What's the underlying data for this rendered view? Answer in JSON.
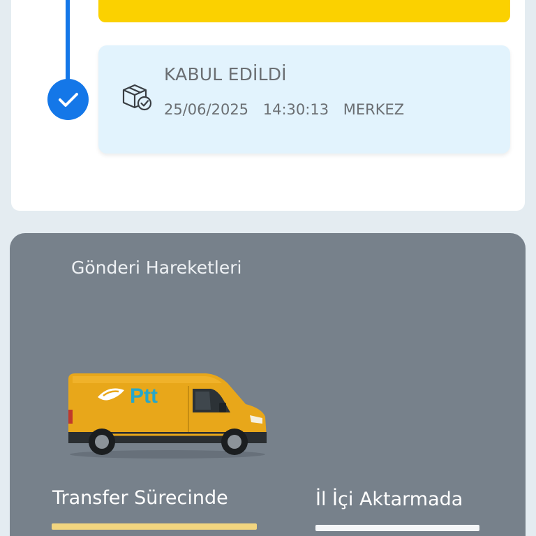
{
  "timeline": {
    "event": {
      "status": "KABUL EDİLDİ",
      "date": "25/06/2025",
      "time": "14:30:13",
      "location": "MERKEZ",
      "icon": "package-check-icon"
    },
    "colors": {
      "accent": "#1477e8",
      "highlight": "#fbd100",
      "event_bg": "#e2f3fd"
    }
  },
  "movements": {
    "title": "Gönderi Hareketleri",
    "van_logo": "Ptt",
    "steps": [
      {
        "label": "Transfer Sürecinde",
        "color": "#f2d57f"
      },
      {
        "label": "İl İçi Aktarmada",
        "color": "#f4f6f8"
      }
    ]
  }
}
